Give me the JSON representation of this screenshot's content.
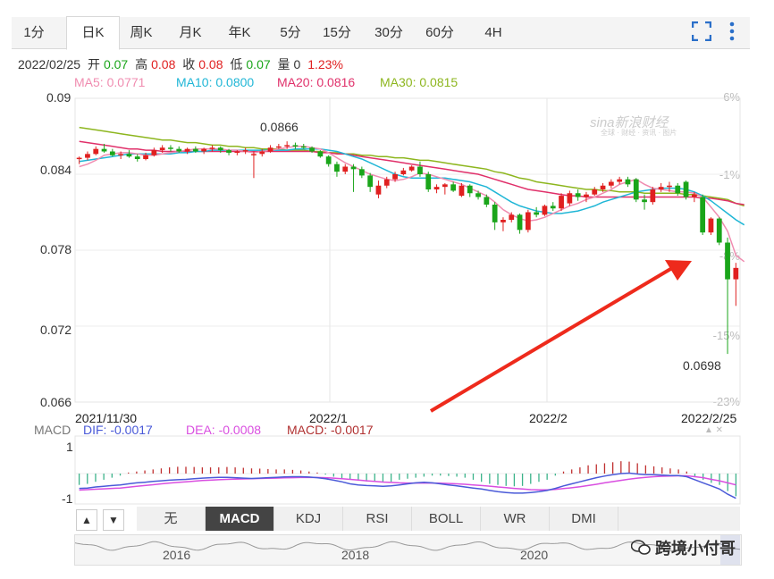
{
  "tabs": [
    "1分",
    "日K",
    "周K",
    "月K",
    "年K",
    "5分",
    "15分",
    "30分",
    "60分",
    "4H"
  ],
  "active_tab": 1,
  "toolbar": {
    "fullscreen_icon": "fullscreen-icon",
    "more_icon": "more-vertical-icon"
  },
  "info": {
    "date": "2022/02/25",
    "open_label": "开",
    "open": "0.07",
    "high_label": "高",
    "high": "0.08",
    "close_label": "收",
    "close": "0.08",
    "low_label": "低",
    "low": "0.07",
    "vol_label": "量",
    "vol": "0",
    "change": "1.23%"
  },
  "ma": {
    "ma5": "MA5: 0.0771",
    "ma10": "MA10: 0.0800",
    "ma20": "MA20: 0.0816",
    "ma30": "MA30: 0.0815"
  },
  "colors": {
    "up": "#e02020",
    "down": "#1aa51a",
    "ma5": "#f08cb0",
    "ma10": "#1fb6d6",
    "ma20": "#e0306a",
    "ma30": "#8db61e",
    "dif": "#4a5ad8",
    "dea": "#d94ee0",
    "arrow": "#ee2a1c"
  },
  "watermark": {
    "main": "sina新浪财经",
    "sub": "全球 · 财经 · 资讯 · 图片"
  },
  "chart_data": {
    "type": "candlestick",
    "y_ticks": [
      "0.09",
      "0.084",
      "0.078",
      "0.072",
      "0.066"
    ],
    "ylim": [
      0.066,
      0.09
    ],
    "pct_ticks": [
      "6%",
      "-1%",
      "-8%",
      "-15%",
      "-23%"
    ],
    "x_ticks": [
      "2021/11/30",
      "2022/1",
      "2022/2",
      "2022/2/25"
    ],
    "annotations": {
      "max": "0.0866",
      "min": "0.0698"
    },
    "ohlc": [
      [
        0.0852,
        0.0854,
        0.0848,
        0.0853
      ],
      [
        0.0853,
        0.0858,
        0.0851,
        0.0856
      ],
      [
        0.0856,
        0.0862,
        0.0855,
        0.086
      ],
      [
        0.086,
        0.0864,
        0.0857,
        0.0858
      ],
      [
        0.0858,
        0.086,
        0.0854,
        0.0855
      ],
      [
        0.0855,
        0.0858,
        0.0852,
        0.0856
      ],
      [
        0.0856,
        0.0859,
        0.0853,
        0.0854
      ],
      [
        0.0854,
        0.0856,
        0.085,
        0.0852
      ],
      [
        0.0852,
        0.0857,
        0.0851,
        0.0855
      ],
      [
        0.0855,
        0.0861,
        0.0854,
        0.0859
      ],
      [
        0.0859,
        0.0863,
        0.0857,
        0.0861
      ],
      [
        0.0861,
        0.0863,
        0.0858,
        0.086
      ],
      [
        0.086,
        0.0862,
        0.0857,
        0.0858
      ],
      [
        0.0858,
        0.0861,
        0.0856,
        0.086
      ],
      [
        0.086,
        0.0862,
        0.0857,
        0.0858
      ],
      [
        0.0858,
        0.0861,
        0.0856,
        0.086
      ],
      [
        0.086,
        0.0863,
        0.0858,
        0.0861
      ],
      [
        0.0861,
        0.0862,
        0.0857,
        0.0859
      ],
      [
        0.0859,
        0.086,
        0.0855,
        0.0857
      ],
      [
        0.0857,
        0.0859,
        0.0855,
        0.0858
      ],
      [
        0.0858,
        0.0861,
        0.0856,
        0.0859
      ],
      [
        0.0855,
        0.0858,
        0.0837,
        0.0856
      ],
      [
        0.0856,
        0.086,
        0.0854,
        0.0858
      ],
      [
        0.0858,
        0.0863,
        0.0857,
        0.0861
      ],
      [
        0.0861,
        0.0864,
        0.086,
        0.0862
      ],
      [
        0.0862,
        0.0866,
        0.086,
        0.0863
      ],
      [
        0.0863,
        0.0865,
        0.086,
        0.0862
      ],
      [
        0.0862,
        0.0864,
        0.086,
        0.0861
      ],
      [
        0.0861,
        0.0862,
        0.0857,
        0.0858
      ],
      [
        0.0858,
        0.0859,
        0.0853,
        0.0854
      ],
      [
        0.0854,
        0.0855,
        0.0846,
        0.0848
      ],
      [
        0.0848,
        0.085,
        0.0838,
        0.0842
      ],
      [
        0.0842,
        0.0848,
        0.084,
        0.0846
      ],
      [
        0.0846,
        0.0848,
        0.0826,
        0.0844
      ],
      [
        0.0844,
        0.0846,
        0.0837,
        0.0839
      ],
      [
        0.0839,
        0.0841,
        0.0826,
        0.083
      ],
      [
        0.0824,
        0.0835,
        0.0821,
        0.0831
      ],
      [
        0.0831,
        0.0838,
        0.0829,
        0.0836
      ],
      [
        0.0836,
        0.0842,
        0.0834,
        0.084
      ],
      [
        0.084,
        0.0845,
        0.0839,
        0.0843
      ],
      [
        0.0843,
        0.0847,
        0.0842,
        0.0846
      ],
      [
        0.0846,
        0.085,
        0.0838,
        0.084
      ],
      [
        0.084,
        0.0842,
        0.0826,
        0.0828
      ],
      [
        0.0828,
        0.0832,
        0.0825,
        0.083
      ],
      [
        0.083,
        0.0833,
        0.0824,
        0.0832
      ],
      [
        0.0832,
        0.0834,
        0.0826,
        0.0827
      ],
      [
        0.0823,
        0.0833,
        0.0822,
        0.0831
      ],
      [
        0.0831,
        0.0832,
        0.0822,
        0.0825
      ],
      [
        0.0825,
        0.0827,
        0.082,
        0.0822
      ],
      [
        0.0822,
        0.0824,
        0.0814,
        0.0816
      ],
      [
        0.0816,
        0.0818,
        0.0796,
        0.0802
      ],
      [
        0.0802,
        0.0806,
        0.0795,
        0.0804
      ],
      [
        0.0804,
        0.081,
        0.0802,
        0.0808
      ],
      [
        0.0808,
        0.0809,
        0.0793,
        0.0796
      ],
      [
        0.0796,
        0.0812,
        0.0794,
        0.081
      ],
      [
        0.081,
        0.0814,
        0.0806,
        0.0808
      ],
      [
        0.0808,
        0.0816,
        0.0807,
        0.0815
      ],
      [
        0.0815,
        0.0818,
        0.0811,
        0.0813
      ],
      [
        0.0813,
        0.0825,
        0.0811,
        0.0823
      ],
      [
        0.0817,
        0.0827,
        0.0815,
        0.0825
      ],
      [
        0.0825,
        0.0828,
        0.0819,
        0.0822
      ],
      [
        0.0822,
        0.0826,
        0.0818,
        0.0824
      ],
      [
        0.0824,
        0.083,
        0.0823,
        0.0828
      ],
      [
        0.0828,
        0.0833,
        0.0826,
        0.0831
      ],
      [
        0.0831,
        0.0836,
        0.0829,
        0.0834
      ],
      [
        0.0834,
        0.0838,
        0.0832,
        0.0836
      ],
      [
        0.0836,
        0.0838,
        0.083,
        0.0832
      ],
      [
        0.0836,
        0.0837,
        0.0818,
        0.082
      ],
      [
        0.082,
        0.0824,
        0.0812,
        0.0818
      ],
      [
        0.0818,
        0.083,
        0.0816,
        0.0828
      ],
      [
        0.0828,
        0.0833,
        0.0826,
        0.083
      ],
      [
        0.083,
        0.0834,
        0.0826,
        0.0831
      ],
      [
        0.0831,
        0.0833,
        0.0823,
        0.0825
      ],
      [
        0.0834,
        0.0835,
        0.082,
        0.0822
      ],
      [
        0.0822,
        0.0826,
        0.0818,
        0.0824
      ],
      [
        0.0822,
        0.0824,
        0.0792,
        0.0794
      ],
      [
        0.0794,
        0.0806,
        0.0792,
        0.0805
      ],
      [
        0.0805,
        0.0806,
        0.0784,
        0.0786
      ],
      [
        0.0786,
        0.079,
        0.0698,
        0.0757
      ],
      [
        0.0757,
        0.077,
        0.0736,
        0.0766
      ]
    ],
    "ma5": [
      0.0846,
      0.0848,
      0.0851,
      0.0855,
      0.0856,
      0.0857,
      0.0857,
      0.0856,
      0.0855,
      0.0855,
      0.0856,
      0.0857,
      0.0858,
      0.0859,
      0.086,
      0.086,
      0.086,
      0.086,
      0.0859,
      0.0859,
      0.0858,
      0.0857,
      0.0858,
      0.0859,
      0.086,
      0.0861,
      0.0862,
      0.0862,
      0.0861,
      0.086,
      0.0857,
      0.0853,
      0.0849,
      0.0846,
      0.0843,
      0.084,
      0.0838,
      0.0836,
      0.0835,
      0.0836,
      0.0838,
      0.0841,
      0.084,
      0.0838,
      0.0836,
      0.0834,
      0.0832,
      0.0829,
      0.0826,
      0.0823,
      0.0818,
      0.0812,
      0.0808,
      0.0805,
      0.0803,
      0.0804,
      0.0806,
      0.0809,
      0.0812,
      0.0815,
      0.0817,
      0.082,
      0.0822,
      0.0825,
      0.0828,
      0.0832,
      0.0834,
      0.0836,
      0.0832,
      0.0829,
      0.0828,
      0.0827,
      0.0826,
      0.0826,
      0.0825,
      0.0822,
      0.0814,
      0.0806,
      0.0795,
      0.0776,
      0.0771
    ],
    "ma10": [
      0.085,
      0.0851,
      0.0852,
      0.0853,
      0.0854,
      0.0855,
      0.0856,
      0.0856,
      0.0856,
      0.0856,
      0.0856,
      0.0856,
      0.0857,
      0.0857,
      0.0858,
      0.0858,
      0.0859,
      0.0859,
      0.0859,
      0.0859,
      0.0859,
      0.0859,
      0.0859,
      0.0859,
      0.0859,
      0.0859,
      0.086,
      0.086,
      0.086,
      0.086,
      0.0859,
      0.0858,
      0.0856,
      0.0854,
      0.0852,
      0.0849,
      0.0846,
      0.0843,
      0.084,
      0.0838,
      0.0837,
      0.0837,
      0.0837,
      0.0837,
      0.0837,
      0.0836,
      0.0835,
      0.0834,
      0.0832,
      0.083,
      0.0826,
      0.0822,
      0.0818,
      0.0815,
      0.0813,
      0.0811,
      0.081,
      0.0809,
      0.0809,
      0.081,
      0.0811,
      0.0813,
      0.0815,
      0.0818,
      0.082,
      0.0822,
      0.0824,
      0.0826,
      0.0827,
      0.0828,
      0.0829,
      0.0829,
      0.0829,
      0.0828,
      0.0826,
      0.0823,
      0.0819,
      0.0814,
      0.0809,
      0.0804,
      0.08
    ],
    "ma20": [
      0.0866,
      0.0865,
      0.0864,
      0.0863,
      0.0862,
      0.0861,
      0.086,
      0.086,
      0.0859,
      0.0859,
      0.0858,
      0.0858,
      0.0858,
      0.0858,
      0.0858,
      0.0858,
      0.0858,
      0.0858,
      0.0858,
      0.0858,
      0.0858,
      0.0858,
      0.0858,
      0.0858,
      0.0858,
      0.0858,
      0.0858,
      0.0858,
      0.0858,
      0.0857,
      0.0857,
      0.0856,
      0.0856,
      0.0855,
      0.0854,
      0.0853,
      0.0852,
      0.0851,
      0.085,
      0.0849,
      0.0848,
      0.0847,
      0.0846,
      0.0845,
      0.0844,
      0.0843,
      0.0842,
      0.0841,
      0.084,
      0.0838,
      0.0836,
      0.0834,
      0.0832,
      0.083,
      0.0828,
      0.0827,
      0.0826,
      0.0825,
      0.0824,
      0.0823,
      0.0823,
      0.0822,
      0.0822,
      0.0822,
      0.0822,
      0.0822,
      0.0822,
      0.0822,
      0.0822,
      0.0822,
      0.0822,
      0.0822,
      0.0822,
      0.0822,
      0.0822,
      0.0821,
      0.0821,
      0.082,
      0.0819,
      0.0817,
      0.0816
    ],
    "ma30": [
      0.0877,
      0.0876,
      0.0875,
      0.0874,
      0.0873,
      0.0872,
      0.0871,
      0.087,
      0.0869,
      0.0868,
      0.0867,
      0.0867,
      0.0866,
      0.0865,
      0.0865,
      0.0864,
      0.0863,
      0.0863,
      0.0862,
      0.0862,
      0.0861,
      0.0861,
      0.086,
      0.086,
      0.086,
      0.0859,
      0.0859,
      0.0859,
      0.0858,
      0.0858,
      0.0857,
      0.0857,
      0.0856,
      0.0856,
      0.0855,
      0.0855,
      0.0854,
      0.0854,
      0.0853,
      0.0853,
      0.0852,
      0.0851,
      0.0851,
      0.085,
      0.0849,
      0.0848,
      0.0847,
      0.0846,
      0.0845,
      0.0844,
      0.0842,
      0.0841,
      0.0839,
      0.0837,
      0.0836,
      0.0834,
      0.0833,
      0.0832,
      0.0831,
      0.083,
      0.0829,
      0.0828,
      0.0828,
      0.0827,
      0.0827,
      0.0826,
      0.0826,
      0.0826,
      0.0825,
      0.0825,
      0.0825,
      0.0825,
      0.0825,
      0.0824,
      0.0824,
      0.0823,
      0.0822,
      0.0821,
      0.082,
      0.0817,
      0.0815
    ],
    "macd": {
      "label": "MACD",
      "dif_label": "DIF: -0.0017",
      "dea_label": "DEA: -0.0008",
      "macd_label": "MACD: -0.0017",
      "y_ticks": [
        "1",
        "-1"
      ],
      "ylim": [
        -1.3,
        1.3
      ],
      "hist": [
        -0.55,
        -0.5,
        -0.4,
        -0.3,
        -0.2,
        -0.1,
        0.05,
        0.1,
        0.15,
        0.2,
        0.25,
        0.3,
        0.33,
        0.33,
        0.32,
        0.3,
        0.3,
        0.3,
        0.32,
        0.3,
        0.28,
        0.25,
        0.24,
        0.22,
        0.2,
        0.2,
        0.18,
        0.15,
        0.1,
        0.05,
        -0.05,
        -0.15,
        -0.25,
        -0.3,
        -0.35,
        -0.38,
        -0.4,
        -0.4,
        -0.4,
        -0.3,
        -0.25,
        -0.2,
        -0.15,
        -0.1,
        -0.1,
        -0.12,
        -0.15,
        -0.2,
        -0.3,
        -0.4,
        -0.5,
        -0.55,
        -0.6,
        -0.62,
        -0.6,
        -0.5,
        -0.4,
        -0.3,
        -0.1,
        0.1,
        0.2,
        0.3,
        0.4,
        0.45,
        0.5,
        0.55,
        0.6,
        0.58,
        0.5,
        0.4,
        0.35,
        0.3,
        0.25,
        0.2,
        0.1,
        -0.15,
        -0.3,
        -0.45,
        -0.55,
        -0.85,
        -1.1
      ],
      "dif": [
        -0.72,
        -0.7,
        -0.65,
        -0.62,
        -0.58,
        -0.55,
        -0.5,
        -0.45,
        -0.42,
        -0.38,
        -0.35,
        -0.32,
        -0.3,
        -0.28,
        -0.25,
        -0.22,
        -0.2,
        -0.18,
        -0.18,
        -0.2,
        -0.22,
        -0.24,
        -0.22,
        -0.2,
        -0.18,
        -0.16,
        -0.15,
        -0.15,
        -0.17,
        -0.2,
        -0.25,
        -0.32,
        -0.4,
        -0.5,
        -0.55,
        -0.58,
        -0.6,
        -0.62,
        -0.6,
        -0.55,
        -0.5,
        -0.45,
        -0.42,
        -0.45,
        -0.5,
        -0.55,
        -0.6,
        -0.65,
        -0.7,
        -0.75,
        -0.82,
        -0.88,
        -0.92,
        -0.95,
        -0.95,
        -0.92,
        -0.88,
        -0.82,
        -0.72,
        -0.6,
        -0.5,
        -0.4,
        -0.3,
        -0.2,
        -0.12,
        -0.05,
        0.0,
        0.02,
        -0.02,
        -0.05,
        -0.05,
        -0.08,
        -0.1,
        -0.1,
        -0.15,
        -0.3,
        -0.45,
        -0.6,
        -0.75,
        -1.0,
        -1.2
      ],
      "dea": [
        -0.8,
        -0.78,
        -0.76,
        -0.74,
        -0.72,
        -0.7,
        -0.66,
        -0.62,
        -0.58,
        -0.54,
        -0.5,
        -0.46,
        -0.43,
        -0.4,
        -0.37,
        -0.34,
        -0.32,
        -0.3,
        -0.28,
        -0.27,
        -0.26,
        -0.25,
        -0.24,
        -0.23,
        -0.22,
        -0.21,
        -0.2,
        -0.19,
        -0.19,
        -0.19,
        -0.2,
        -0.22,
        -0.25,
        -0.28,
        -0.31,
        -0.35,
        -0.38,
        -0.41,
        -0.43,
        -0.45,
        -0.46,
        -0.46,
        -0.46,
        -0.46,
        -0.47,
        -0.48,
        -0.5,
        -0.52,
        -0.55,
        -0.58,
        -0.61,
        -0.65,
        -0.68,
        -0.72,
        -0.75,
        -0.78,
        -0.79,
        -0.79,
        -0.77,
        -0.73,
        -0.69,
        -0.64,
        -0.58,
        -0.52,
        -0.45,
        -0.39,
        -0.33,
        -0.27,
        -0.22,
        -0.18,
        -0.15,
        -0.13,
        -0.12,
        -0.11,
        -0.11,
        -0.15,
        -0.2,
        -0.28,
        -0.35,
        -0.45,
        -0.55
      ]
    }
  },
  "indicators": [
    "无",
    "MACD",
    "KDJ",
    "RSI",
    "BOLL",
    "WR",
    "DMI"
  ],
  "active_indicator": 1,
  "nav": {
    "years": [
      "2016",
      "2018",
      "2020"
    ]
  },
  "stamp": "跨境小付哥"
}
